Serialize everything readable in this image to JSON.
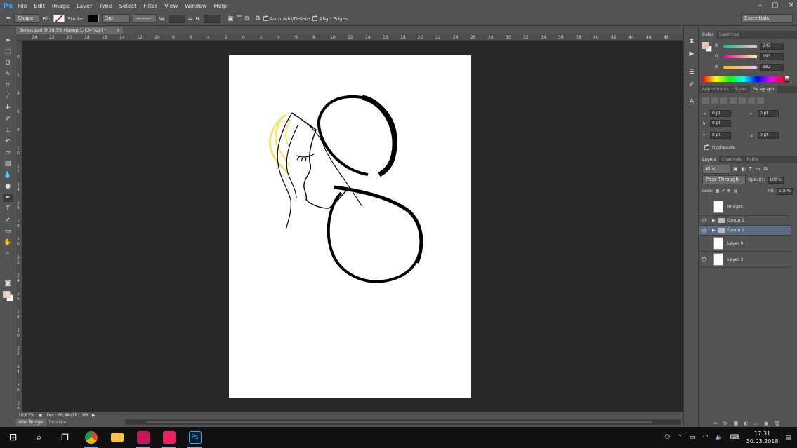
{
  "app": {
    "logo": "Ps"
  },
  "menu": [
    "File",
    "Edit",
    "Image",
    "Layer",
    "Type",
    "Select",
    "Filter",
    "View",
    "Window",
    "Help"
  ],
  "window_controls": {
    "minimize": "–",
    "maximize": "▢",
    "close": "✕"
  },
  "options_bar": {
    "mode": "Shape",
    "fill_label": "Fill:",
    "stroke_label": "Stroke:",
    "stroke_width": "3pt",
    "w_label": "W:",
    "h_label": "H:",
    "auto_add_delete": "Auto Add/Delete",
    "align_edges": "Align Edges",
    "workspace": "Essentials"
  },
  "document_tab": {
    "title": "Bmart.psd @ 16,7% (Group 1, CMYK/8) *",
    "close": "×"
  },
  "ruler_top_labels": [
    "24",
    "22",
    "20",
    "18",
    "16",
    "14",
    "12",
    "10",
    "8",
    "6",
    "4",
    "2",
    "0",
    "2",
    "4",
    "6",
    "8",
    "10",
    "12",
    "14",
    "16",
    "18",
    "20",
    "22",
    "24",
    "26",
    "28",
    "30",
    "32",
    "34",
    "36",
    "38",
    "40",
    "42",
    "44",
    "46",
    "48"
  ],
  "ruler_left_labels": [
    "0",
    "2",
    "4",
    "6",
    "8",
    "1 0",
    "1 2",
    "1 4",
    "1 6",
    "1 8",
    "2 0",
    "2 2",
    "2 4",
    "2 6",
    "2 8",
    "3 0",
    "3 2",
    "3 4",
    "3 6",
    "3 8"
  ],
  "status": {
    "zoom": "16,67%",
    "doc": "Doc: 66,4M/181,1M"
  },
  "bottom_tabs": [
    "Mini Bridge",
    "Timeline"
  ],
  "color_panel": {
    "tabs": [
      "Color",
      "Swatches"
    ],
    "r": "243",
    "g": "193",
    "b": "162",
    "labels": {
      "r": "R",
      "g": "G",
      "b": "B"
    },
    "foreground": "#f3c1a2"
  },
  "paragraph_panel": {
    "tabs": [
      "Adjustments",
      "Styles",
      "Paragraph"
    ],
    "indent_left": "0 pt",
    "indent_right": "0 pt",
    "indent_first": "0 pt",
    "space_before": "0 pt",
    "space_after": "0 pt",
    "hyphenate": "Hyphenate"
  },
  "layers_panel": {
    "tabs": [
      "Layers",
      "Channels",
      "Paths"
    ],
    "filter_kind": "Kind",
    "blend_mode": "Pass Through",
    "opacity_label": "Opacity:",
    "opacity": "100%",
    "lock_label": "Lock:",
    "fill_label": "Fill:",
    "fill": "100%",
    "layers": [
      {
        "name": "Images",
        "type": "smart",
        "visible": false
      },
      {
        "name": "Group 2",
        "type": "group",
        "visible": true
      },
      {
        "name": "Group 1",
        "type": "group",
        "visible": true,
        "selected": true
      },
      {
        "name": "Layer 0",
        "type": "layer",
        "visible": false
      },
      {
        "name": "Layer 3",
        "type": "layer",
        "visible": true
      }
    ]
  },
  "taskbar": {
    "time": "17:31",
    "date": "30.03.2018",
    "apps": [
      "Start",
      "Search",
      "Task View",
      "Chrome",
      "File Explorer",
      "WhatsApp",
      "Instagram",
      "Photoshop"
    ]
  },
  "colors": {
    "accent": "#31a8ff",
    "selected_layer": "#5c6c85",
    "artwork_yellow": "#f5e66b"
  }
}
